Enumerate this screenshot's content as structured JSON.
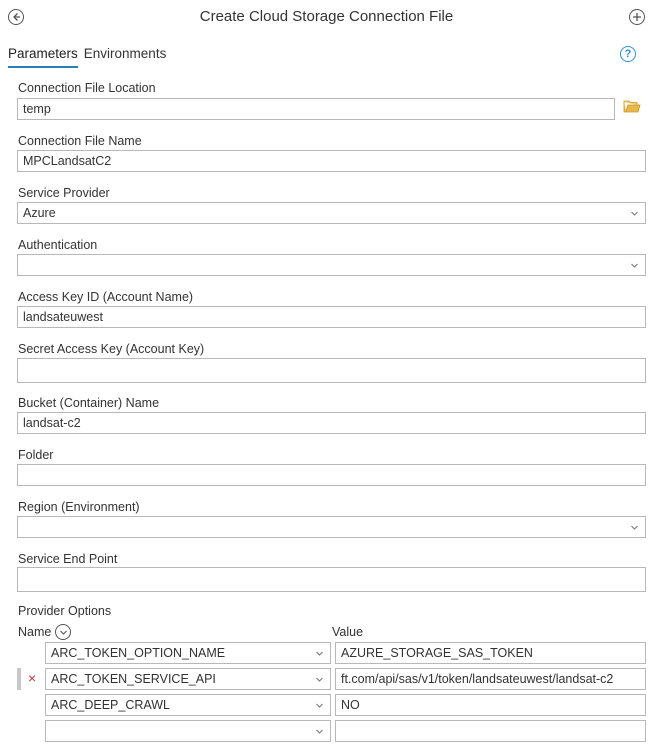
{
  "header": {
    "title": "Create Cloud Storage Connection File",
    "back_icon": "back-arrow-icon",
    "add_icon": "plus-icon"
  },
  "tabs": [
    {
      "label": "Parameters",
      "active": true
    },
    {
      "label": "Environments",
      "active": false
    }
  ],
  "help_symbol": "?",
  "fields": {
    "connection_file_location": {
      "label": "Connection File Location",
      "value": "temp"
    },
    "connection_file_name": {
      "label": "Connection File Name",
      "value": "MPCLandsatC2"
    },
    "service_provider": {
      "label": "Service Provider",
      "value": "Azure"
    },
    "authentication": {
      "label": "Authentication",
      "value": ""
    },
    "access_key_id": {
      "label": "Access Key ID (Account Name)",
      "value": "landsateuwest"
    },
    "secret_access_key": {
      "label": "Secret Access Key (Account Key)",
      "value": ""
    },
    "bucket_name": {
      "label": "Bucket (Container) Name",
      "value": "landsat-c2"
    },
    "folder": {
      "label": "Folder",
      "value": ""
    },
    "region": {
      "label": "Region (Environment)",
      "value": ""
    },
    "service_end_point": {
      "label": "Service End Point",
      "value": ""
    }
  },
  "provider_options": {
    "label": "Provider Options",
    "name_header": "Name",
    "value_header": "Value",
    "rows": [
      {
        "name": "ARC_TOKEN_OPTION_NAME",
        "value": "AZURE_STORAGE_SAS_TOKEN"
      },
      {
        "name": "ARC_TOKEN_SERVICE_API",
        "value": "ft.com/api/sas/v1/token/landsateuwest/landsat-c2"
      },
      {
        "name": "ARC_DEEP_CRAWL",
        "value": "NO"
      },
      {
        "name": "",
        "value": ""
      }
    ]
  },
  "colors": {
    "accent": "#2a7fb8",
    "help": "#2f8fd0",
    "delete": "#c0392b",
    "folder": "#e8b84a"
  }
}
